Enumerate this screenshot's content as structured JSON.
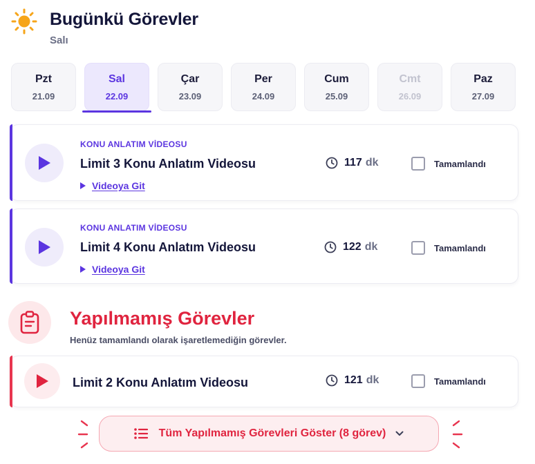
{
  "header": {
    "title": "Bugünkü Görevler",
    "subtitle": "Salı",
    "icon": "sun-icon"
  },
  "days": [
    {
      "name": "Pzt",
      "date": "21.09",
      "state": "normal"
    },
    {
      "name": "Sal",
      "date": "22.09",
      "state": "active"
    },
    {
      "name": "Çar",
      "date": "23.09",
      "state": "normal"
    },
    {
      "name": "Per",
      "date": "24.09",
      "state": "normal"
    },
    {
      "name": "Cum",
      "date": "25.09",
      "state": "normal"
    },
    {
      "name": "Cmt",
      "date": "26.09",
      "state": "disabled"
    },
    {
      "name": "Paz",
      "date": "27.09",
      "state": "normal"
    }
  ],
  "today_tasks": [
    {
      "kicker": "KONU ANLATIM VİDEOSU",
      "title": "Limit 3 Konu Anlatım Videosu",
      "link": "Videoya Git",
      "duration": "117",
      "unit": "dk",
      "check_label": "Tamamlandı",
      "done": false
    },
    {
      "kicker": "KONU ANLATIM VİDEOSU",
      "title": "Limit 4 Konu Anlatım Videosu",
      "link": "Videoya Git",
      "duration": "122",
      "unit": "dk",
      "check_label": "Tamamlandı",
      "done": false
    }
  ],
  "missed_section": {
    "title": "Yapılmamış Görevler",
    "subtitle": "Henüz tamamlandı olarak işaretlemediğin görevler.",
    "icon": "clipboard-icon"
  },
  "missed_tasks": [
    {
      "title": "Limit 2 Konu Anlatım Videosu",
      "duration": "121",
      "unit": "dk",
      "check_label": "Tamamlandı",
      "done": false
    }
  ],
  "show_all_button": {
    "label": "Tüm Yapılmamış Görevleri Göster (8 görev)"
  },
  "colors": {
    "accent": "#5b35e0",
    "danger": "#e0243f",
    "sun": "#f6a51a"
  }
}
